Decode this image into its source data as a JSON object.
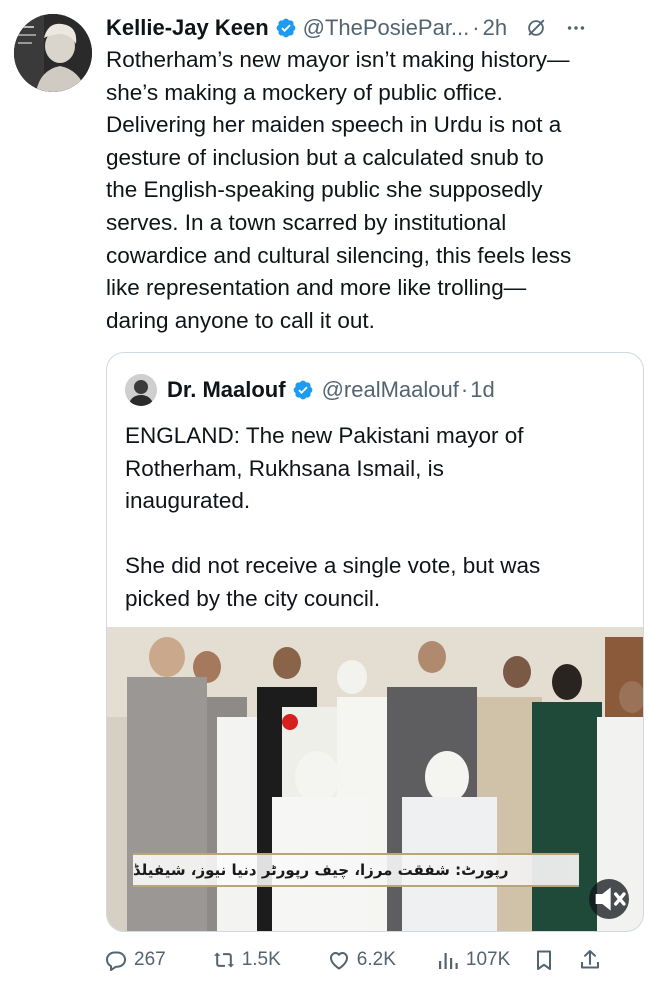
{
  "tweet": {
    "author_name": "Kellie-Jay Keen",
    "handle": "@ThePosiePar...",
    "separator": "·",
    "time": "2h",
    "text": "Rotherham’s new mayor isn’t making history—\nshe’s making a mockery of public office.\nDelivering her maiden speech in Urdu is not a\ngesture of inclusion but a calculated snub to\nthe English-speaking public she supposedly\nserves. In a town scarred by institutional\ncowardice and cultural silencing, this feels less\nlike representation and more like trolling—\ndaring anyone to call it out."
  },
  "quote": {
    "author_name": "Dr. Maalouf",
    "handle": "@realMaalouf",
    "separator": "·",
    "time": "1d",
    "text": "ENGLAND: The new Pakistani mayor of\nRotherham, Rukhsana Ismail, is\ninaugurated.\n\nShe did not receive a single vote, but was\npicked by the city council.",
    "media_caption": "رپورٹ: شفقت مرزا، چیف رپورٹر دنیا نیوز، شیفیلڈ"
  },
  "actions": {
    "replies": "267",
    "reposts": "1.5K",
    "likes": "6.2K",
    "views": "107K"
  },
  "icons": {
    "verified": "verified-badge-icon",
    "grok": "grok-icon",
    "more": "more-icon",
    "mute": "mute-icon",
    "reply": "reply-icon",
    "repost": "repost-icon",
    "like": "like-icon",
    "views": "views-icon",
    "bookmark": "bookmark-icon",
    "share": "share-icon"
  },
  "colors": {
    "verified_blue": "#1d9bf0",
    "text": "#0f1419",
    "muted": "#536471",
    "border": "#cfd9de"
  }
}
